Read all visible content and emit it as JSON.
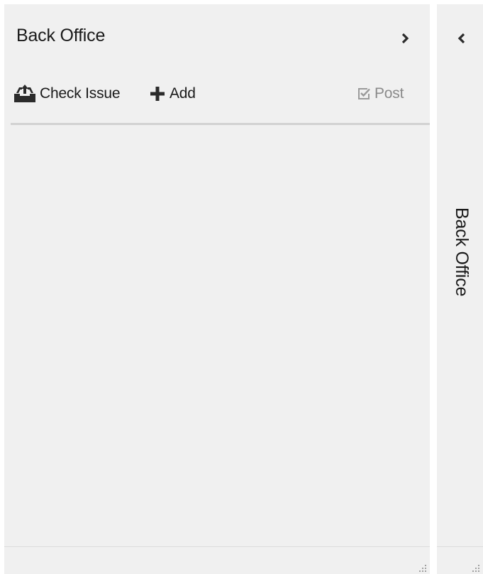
{
  "panel": {
    "title": "Back Office",
    "collapse_icon": "chevron-right-icon"
  },
  "toolbar": {
    "check_issue": {
      "label": "Check Issue",
      "icon": "inbox-upload-icon"
    },
    "add": {
      "label": "Add",
      "icon": "plus-icon"
    },
    "post": {
      "label": "Post",
      "icon": "checkbox-check-icon",
      "enabled": false
    }
  },
  "side_panel": {
    "title": "Back Office",
    "expand_icon": "chevron-left-icon"
  },
  "colors": {
    "panel_bg": "#f0f0f0",
    "text": "#1a1a1a",
    "disabled_text": "#8a8a8a",
    "divider": "#d2d2d2"
  }
}
